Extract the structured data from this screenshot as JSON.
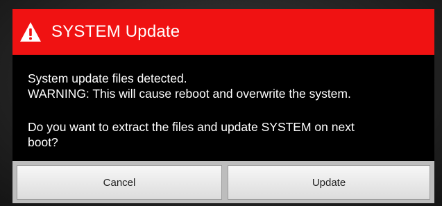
{
  "dialog": {
    "title": "SYSTEM Update",
    "title_icon": "warning-icon",
    "accent_color": "#f01212",
    "message_lines": [
      "System update files detected.",
      "WARNING: This will cause reboot and overwrite the system.",
      "Do you want to extract the files and update SYSTEM on next",
      "boot?"
    ],
    "buttons": {
      "cancel_label": "Cancel",
      "update_label": "Update"
    }
  }
}
